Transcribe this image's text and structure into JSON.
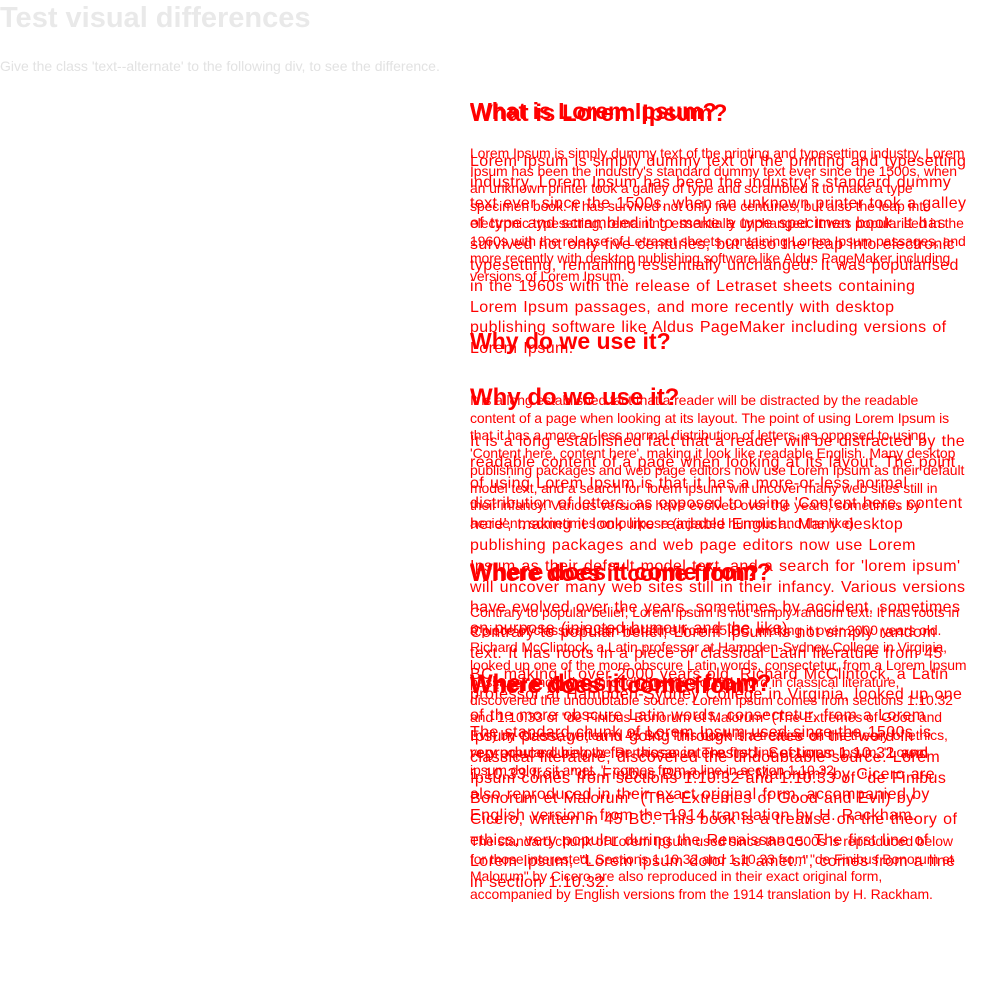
{
  "page": {
    "title": "Test visual differences",
    "subtitle": "Give the class 'text--alternate' to the following div, to see the difference."
  },
  "sections": [
    {
      "heading": "What is Lorem Ipsum?",
      "body": "Lorem Ipsum is simply dummy text of the printing and typesetting industry. Lorem Ipsum has been the industry's standard dummy text ever since the 1500s, when an unknown printer took a galley of type and scrambled it to make a type specimen book. It has survived not only five centuries, but also the leap into electronic typesetting, remaining essentially unchanged. It was popularised in the 1960s with the release of Letraset sheets containing Lorem Ipsum passages, and more recently with desktop publishing software like Aldus PageMaker including versions of Lorem Ipsum."
    },
    {
      "heading": "Why do we use it?",
      "body": "It is a long established fact that a reader will be distracted by the readable content of a page when looking at its layout. The point of using Lorem Ipsum is that it has a more-or-less normal distribution of letters, as opposed to using 'Content here, content here', making it look like readable English. Many desktop publishing packages and web page editors now use Lorem Ipsum as their default model text, and a search for 'lorem ipsum' will uncover many web sites still in their infancy. Various versions have evolved over the years, sometimes by accident, sometimes on purpose (injected humour and the like)."
    },
    {
      "heading": "Where does it come from?",
      "body": "Contrary to popular belief, Lorem Ipsum is not simply random text. It has roots in a piece of classical Latin literature from 45 BC, making it over 2000 years old. Richard McClintock, a Latin professor at Hampden-Sydney College in Virginia, looked up one of the more obscure Latin words, consectetur, from a Lorem Ipsum passage, and going through the cites of the word in classical literature, discovered the undoubtable source. Lorem Ipsum comes from sections 1.10.32 and 1.10.33 of \"de Finibus Bonorum et Malorum\" (The Extremes of Good and Evil) by Cicero, written in 45 BC. This book is a treatise on the theory of ethics, very popular during the Renaissance. The first line of Lorem Ipsum, \"Lorem ipsum dolor sit amet..\", comes from a line in section 1.10.32."
    },
    {
      "heading": "Where does it come from?",
      "body": "The standard chunk of Lorem Ipsum used since the 1500s is reproduced below for those interested. Sections 1.10.32 and 1.10.33 from \"de Finibus Bonorum et Malorum\" by Cicero are also reproduced in their exact original form, accompanied by English versions from the 1914 translation by H. Rackham."
    }
  ],
  "colors": {
    "diff": "#ff0000",
    "title": "#e9e9e9",
    "subtitle": "#e2e2e2",
    "background": "#ffffff"
  }
}
